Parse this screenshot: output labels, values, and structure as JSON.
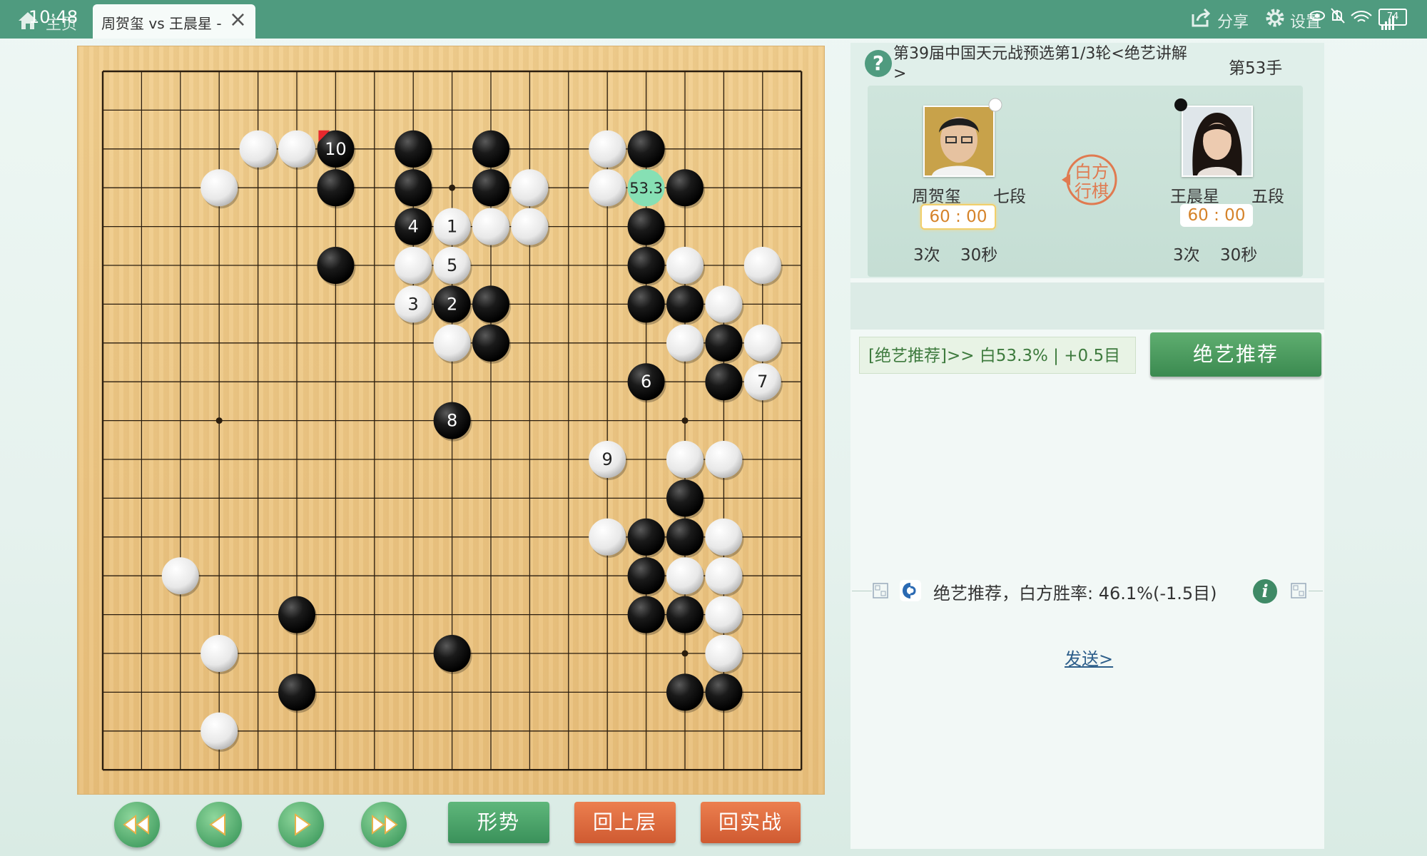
{
  "status_bar": {
    "time": "10:48",
    "battery": "74"
  },
  "top_bar": {
    "home_label": "主页",
    "tab_title": "周贺玺 vs 王晨星 -",
    "share_label": "分享",
    "settings_label": "设置"
  },
  "game": {
    "title": "第39届中国天元战预选第1/3轮<绝艺讲解>",
    "move_label": "第53手",
    "turn_badge": [
      "白方",
      "行棋"
    ],
    "white_player": {
      "name": "周贺玺",
      "rank": "七段",
      "clock": "60 : 00",
      "byoyomi_count": "3次",
      "byoyomi_time": "30秒",
      "stone": "white"
    },
    "black_player": {
      "name": "王晨星",
      "rank": "五段",
      "clock": "60 : 00",
      "byoyomi_count": "3次",
      "byoyomi_time": "30秒",
      "stone": "black"
    }
  },
  "board": {
    "size": 19,
    "last_move_marker_color": "#e8282d",
    "highlight_color": "#86e0b4",
    "stones": [
      {
        "c": 4,
        "r": 2,
        "color": "white"
      },
      {
        "c": 5,
        "r": 2,
        "color": "white"
      },
      {
        "c": 6,
        "r": 2,
        "color": "black",
        "label": "10",
        "last": true
      },
      {
        "c": 8,
        "r": 2,
        "color": "black"
      },
      {
        "c": 10,
        "r": 2,
        "color": "black"
      },
      {
        "c": 13,
        "r": 2,
        "color": "white"
      },
      {
        "c": 14,
        "r": 2,
        "color": "black"
      },
      {
        "c": 3,
        "r": 3,
        "color": "white"
      },
      {
        "c": 6,
        "r": 3,
        "color": "black"
      },
      {
        "c": 8,
        "r": 3,
        "color": "black"
      },
      {
        "c": 10,
        "r": 3,
        "color": "black"
      },
      {
        "c": 11,
        "r": 3,
        "color": "white"
      },
      {
        "c": 13,
        "r": 3,
        "color": "white"
      },
      {
        "c": 14,
        "r": 3,
        "color": "highlight",
        "label": "53.3"
      },
      {
        "c": 15,
        "r": 3,
        "color": "black"
      },
      {
        "c": 8,
        "r": 4,
        "color": "black",
        "label": "4"
      },
      {
        "c": 9,
        "r": 4,
        "color": "white",
        "label": "1"
      },
      {
        "c": 10,
        "r": 4,
        "color": "white"
      },
      {
        "c": 11,
        "r": 4,
        "color": "white"
      },
      {
        "c": 14,
        "r": 4,
        "color": "black"
      },
      {
        "c": 6,
        "r": 5,
        "color": "black"
      },
      {
        "c": 8,
        "r": 5,
        "color": "white"
      },
      {
        "c": 9,
        "r": 5,
        "color": "white",
        "label": "5"
      },
      {
        "c": 14,
        "r": 5,
        "color": "black"
      },
      {
        "c": 15,
        "r": 5,
        "color": "white"
      },
      {
        "c": 17,
        "r": 5,
        "color": "white"
      },
      {
        "c": 8,
        "r": 6,
        "color": "white",
        "label": "3"
      },
      {
        "c": 9,
        "r": 6,
        "color": "black",
        "label": "2"
      },
      {
        "c": 10,
        "r": 6,
        "color": "black"
      },
      {
        "c": 14,
        "r": 6,
        "color": "black"
      },
      {
        "c": 15,
        "r": 6,
        "color": "black"
      },
      {
        "c": 16,
        "r": 6,
        "color": "white"
      },
      {
        "c": 9,
        "r": 7,
        "color": "white"
      },
      {
        "c": 10,
        "r": 7,
        "color": "black"
      },
      {
        "c": 15,
        "r": 7,
        "color": "white"
      },
      {
        "c": 16,
        "r": 7,
        "color": "black"
      },
      {
        "c": 17,
        "r": 7,
        "color": "white"
      },
      {
        "c": 14,
        "r": 8,
        "color": "black",
        "label": "6"
      },
      {
        "c": 16,
        "r": 8,
        "color": "black"
      },
      {
        "c": 17,
        "r": 8,
        "color": "white",
        "label": "7"
      },
      {
        "c": 9,
        "r": 9,
        "color": "black",
        "label": "8"
      },
      {
        "c": 13,
        "r": 10,
        "color": "white",
        "label": "9"
      },
      {
        "c": 15,
        "r": 10,
        "color": "white"
      },
      {
        "c": 16,
        "r": 10,
        "color": "white"
      },
      {
        "c": 15,
        "r": 11,
        "color": "black"
      },
      {
        "c": 13,
        "r": 12,
        "color": "white"
      },
      {
        "c": 14,
        "r": 12,
        "color": "black"
      },
      {
        "c": 15,
        "r": 12,
        "color": "black"
      },
      {
        "c": 16,
        "r": 12,
        "color": "white"
      },
      {
        "c": 2,
        "r": 13,
        "color": "white"
      },
      {
        "c": 14,
        "r": 13,
        "color": "black"
      },
      {
        "c": 15,
        "r": 13,
        "color": "white"
      },
      {
        "c": 16,
        "r": 13,
        "color": "white"
      },
      {
        "c": 5,
        "r": 14,
        "color": "black"
      },
      {
        "c": 14,
        "r": 14,
        "color": "black"
      },
      {
        "c": 15,
        "r": 14,
        "color": "black"
      },
      {
        "c": 16,
        "r": 14,
        "color": "white"
      },
      {
        "c": 3,
        "r": 15,
        "color": "white"
      },
      {
        "c": 9,
        "r": 15,
        "color": "black"
      },
      {
        "c": 16,
        "r": 15,
        "color": "white"
      },
      {
        "c": 5,
        "r": 16,
        "color": "black"
      },
      {
        "c": 15,
        "r": 16,
        "color": "black"
      },
      {
        "c": 16,
        "r": 16,
        "color": "black"
      },
      {
        "c": 3,
        "r": 17,
        "color": "white"
      }
    ]
  },
  "controls": {
    "first_icon": "double-left-arrow",
    "prev_icon": "left-arrow",
    "next_icon": "right-arrow",
    "last_icon": "double-right-arrow",
    "situation_label": "形势",
    "back_level_label": "回上层",
    "back_real_label": "回实战"
  },
  "ai": {
    "recommend_text": "[绝艺推荐]>> 白53.3% | +0.5目",
    "recommend_button": "绝艺推荐",
    "win_rate_text": "绝艺推荐，白方胜率: 46.1%(-1.5目)",
    "send_link": "发送>"
  }
}
